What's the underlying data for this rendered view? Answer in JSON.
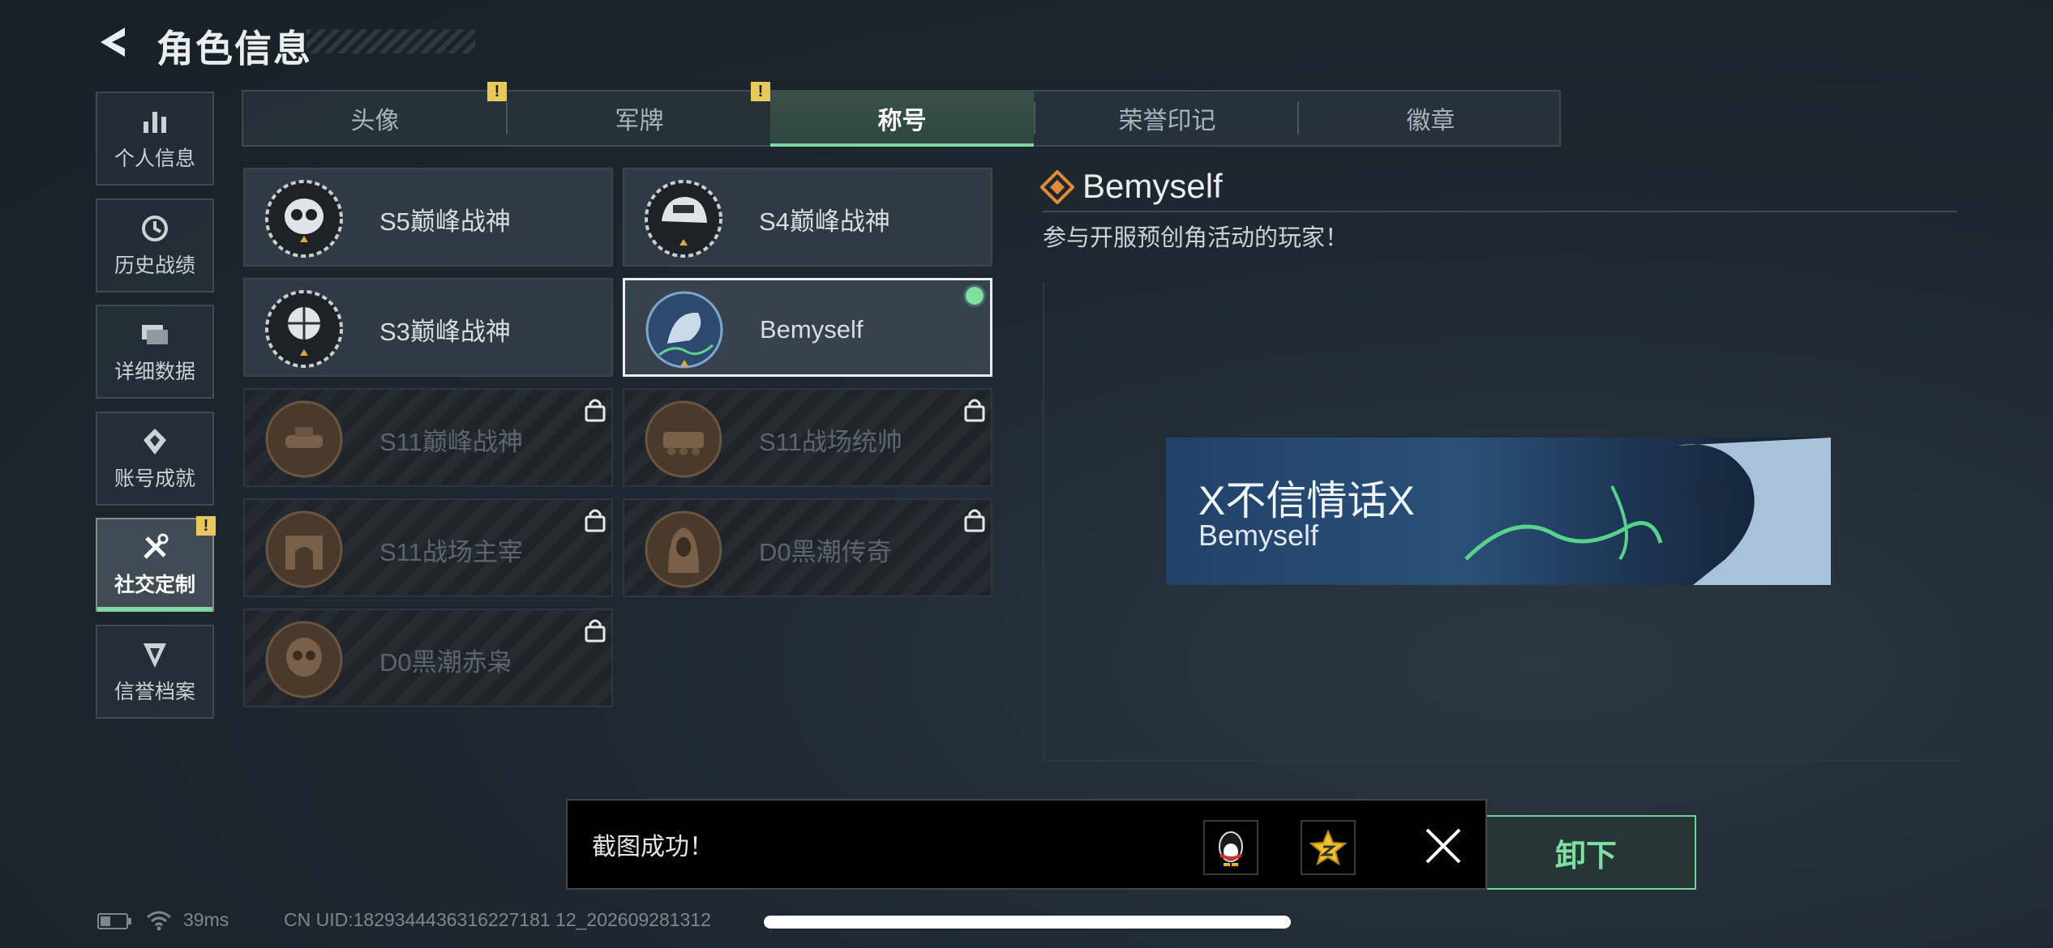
{
  "header": {
    "title": "角色信息"
  },
  "nav": [
    {
      "label": "个人信息",
      "icon": "bar-chart-icon"
    },
    {
      "label": "历史战绩",
      "icon": "clock-icon"
    },
    {
      "label": "详细数据",
      "icon": "folder-icon"
    },
    {
      "label": "账号成就",
      "icon": "achievement-icon"
    },
    {
      "label": "社交定制",
      "icon": "tools-icon",
      "active": true,
      "badge": "!"
    },
    {
      "label": "信誉档案",
      "icon": "credit-icon"
    }
  ],
  "tabs": [
    {
      "label": "头像",
      "badge": "!"
    },
    {
      "label": "军牌",
      "badge": "!"
    },
    {
      "label": "称号",
      "active": true
    },
    {
      "label": "荣誉印记"
    },
    {
      "label": "徽章"
    }
  ],
  "titles": [
    {
      "name": "S5巅峰战神",
      "locked": false
    },
    {
      "name": "S4巅峰战神",
      "locked": false
    },
    {
      "name": "S3巅峰战神",
      "locked": false
    },
    {
      "name": "Bemyself",
      "locked": false,
      "selected": true,
      "equipped": true
    },
    {
      "name": "S11巅峰战神",
      "locked": true
    },
    {
      "name": "S11战场统帅",
      "locked": true
    },
    {
      "name": "S11战场主宰",
      "locked": true
    },
    {
      "name": "D0黑潮传奇",
      "locked": true
    },
    {
      "name": "D0黑潮赤枭",
      "locked": true
    }
  ],
  "detail": {
    "name": "Bemyself",
    "description": "参与开服预创角活动的玩家！",
    "banner_player_name": "X不信情话X",
    "banner_title": "Bemyself",
    "action_button_partial": "卸下"
  },
  "toast": {
    "message": "截图成功！",
    "close_icon": "close-icon"
  },
  "status": {
    "ping": "39ms",
    "uid": "CN UID:1829344436316227181 12_202609281312"
  },
  "colors": {
    "accent": "#7fd6a3",
    "badge": "#e7c85a"
  }
}
